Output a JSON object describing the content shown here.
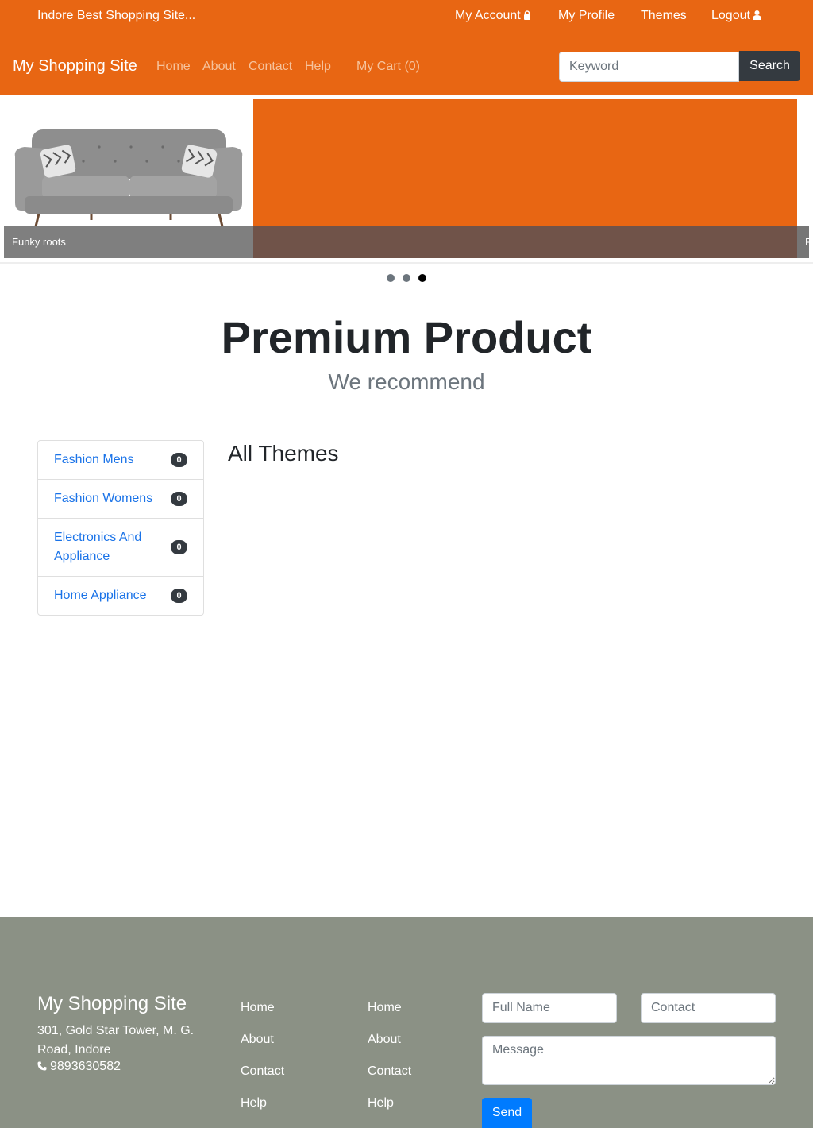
{
  "topbar": {
    "tagline": "Indore Best Shopping Site...",
    "my_account": "My Account",
    "my_profile": "My Profile",
    "themes": "Themes",
    "logout": "Logout"
  },
  "navbar": {
    "brand": "My Shopping Site",
    "links": [
      "Home",
      "About",
      "Contact",
      "Help"
    ],
    "cart": "My Cart (0)",
    "search_placeholder": "Keyword",
    "search_button": "Search"
  },
  "carousel": {
    "caption": "Funky roots",
    "next_caption_fragment": "F",
    "slide_count": 3,
    "active_index": 2,
    "colors": {
      "slide_bg": "#e86613"
    }
  },
  "hero": {
    "title": "Premium Product",
    "subtitle": "We recommend"
  },
  "categories": [
    {
      "label": "Fashion Mens",
      "count": "0"
    },
    {
      "label": "Fashion Womens",
      "count": "0"
    },
    {
      "label": "Electronics And Appliance",
      "count": "0"
    },
    {
      "label": "Home Appliance",
      "count": "0"
    }
  ],
  "main": {
    "heading": "All Themes"
  },
  "footer": {
    "brand": "My Shopping Site",
    "address": "301, Gold Star Tower, M. G. Road, Indore",
    "phone": "9893630582",
    "links_col1": [
      "Home",
      "About",
      "Contact",
      "Help"
    ],
    "links_col2": [
      "Home",
      "About",
      "Contact",
      "Help"
    ],
    "form": {
      "name_placeholder": "Full Name",
      "contact_placeholder": "Contact",
      "message_placeholder": "Message",
      "send_label": "Send"
    }
  },
  "colors": {
    "brand": "#e86613",
    "footer_bg": "#8b9185",
    "link": "#1a73e8",
    "primary_button": "#007bff",
    "dark_button": "#343a40"
  }
}
